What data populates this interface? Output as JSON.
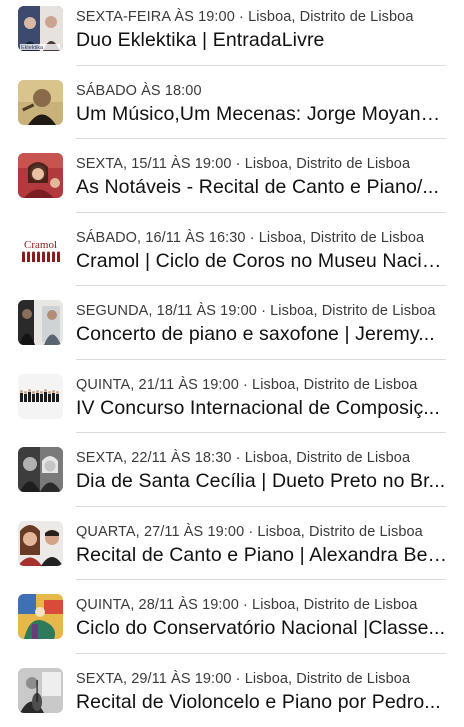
{
  "events": [
    {
      "date": "SEXTA-FEIRA ÀS 19:00 · Lisboa, Distrito de Lisboa",
      "title": "Duo Eklektika | EntradaLivre",
      "thumb_text": "Eklektika",
      "thumb_icon": "duo-eklektika-thumbnail"
    },
    {
      "date": "SÁBADO ÀS 18:00",
      "title": "Um Músico,Um Mecenas: Jorge Moyano...",
      "thumb_icon": "musician-portrait-thumbnail"
    },
    {
      "date": "SEXTA, 15/11 ÀS 19:00 · Lisboa, Distrito de Lisboa",
      "title": "As Notáveis - Recital de Canto e Piano/...",
      "thumb_icon": "singer-portrait-thumbnail"
    },
    {
      "date": "SÁBADO, 16/11 ÀS 16:30 · Lisboa, Distrito de Lisboa",
      "title": "Cramol | Ciclo de Coros no Museu Nacio...",
      "thumb_text": "Cramol",
      "thumb_icon": "cramol-logo-thumbnail"
    },
    {
      "date": "SEGUNDA, 18/11 ÀS 19:00 · Lisboa, Distrito de Lisboa",
      "title": "Concerto de piano e saxofone | Jeremy...",
      "thumb_icon": "duo-photo-thumbnail"
    },
    {
      "date": "QUINTA, 21/11 ÀS 19:00 · Lisboa, Distrito de Lisboa",
      "title": "IV Concurso Internacional de Composiç...",
      "thumb_icon": "ensemble-photo-thumbnail"
    },
    {
      "date": "SEXTA, 22/11 ÀS 18:30 · Lisboa, Distrito de Lisboa",
      "title": "Dia de Santa Cecília | Dueto Preto no Br...",
      "thumb_icon": "bw-duo-portrait-thumbnail"
    },
    {
      "date": "QUARTA, 27/11 ÀS 19:00 · Lisboa, Distrito de Lisboa",
      "title": "Recital de Canto e Piano | Alexandra Ber...",
      "thumb_icon": "couple-portrait-thumbnail"
    },
    {
      "date": "QUINTA, 28/11 ÀS 19:00 · Lisboa, Distrito de Lisboa",
      "title": "Ciclo do Conservatório Nacional |Classe...",
      "thumb_icon": "abstract-painting-thumbnail"
    },
    {
      "date": "SEXTA, 29/11 ÀS 19:00 · Lisboa, Distrito de Lisboa",
      "title": "Recital de Violoncelo e Piano por Pedro...",
      "thumb_icon": "cellist-photo-thumbnail"
    }
  ],
  "colors": {
    "date_text": "#3a3a3c",
    "title_text": "#111111",
    "divider": "#d9d9de",
    "cramol_red": "#8b1a1a"
  }
}
